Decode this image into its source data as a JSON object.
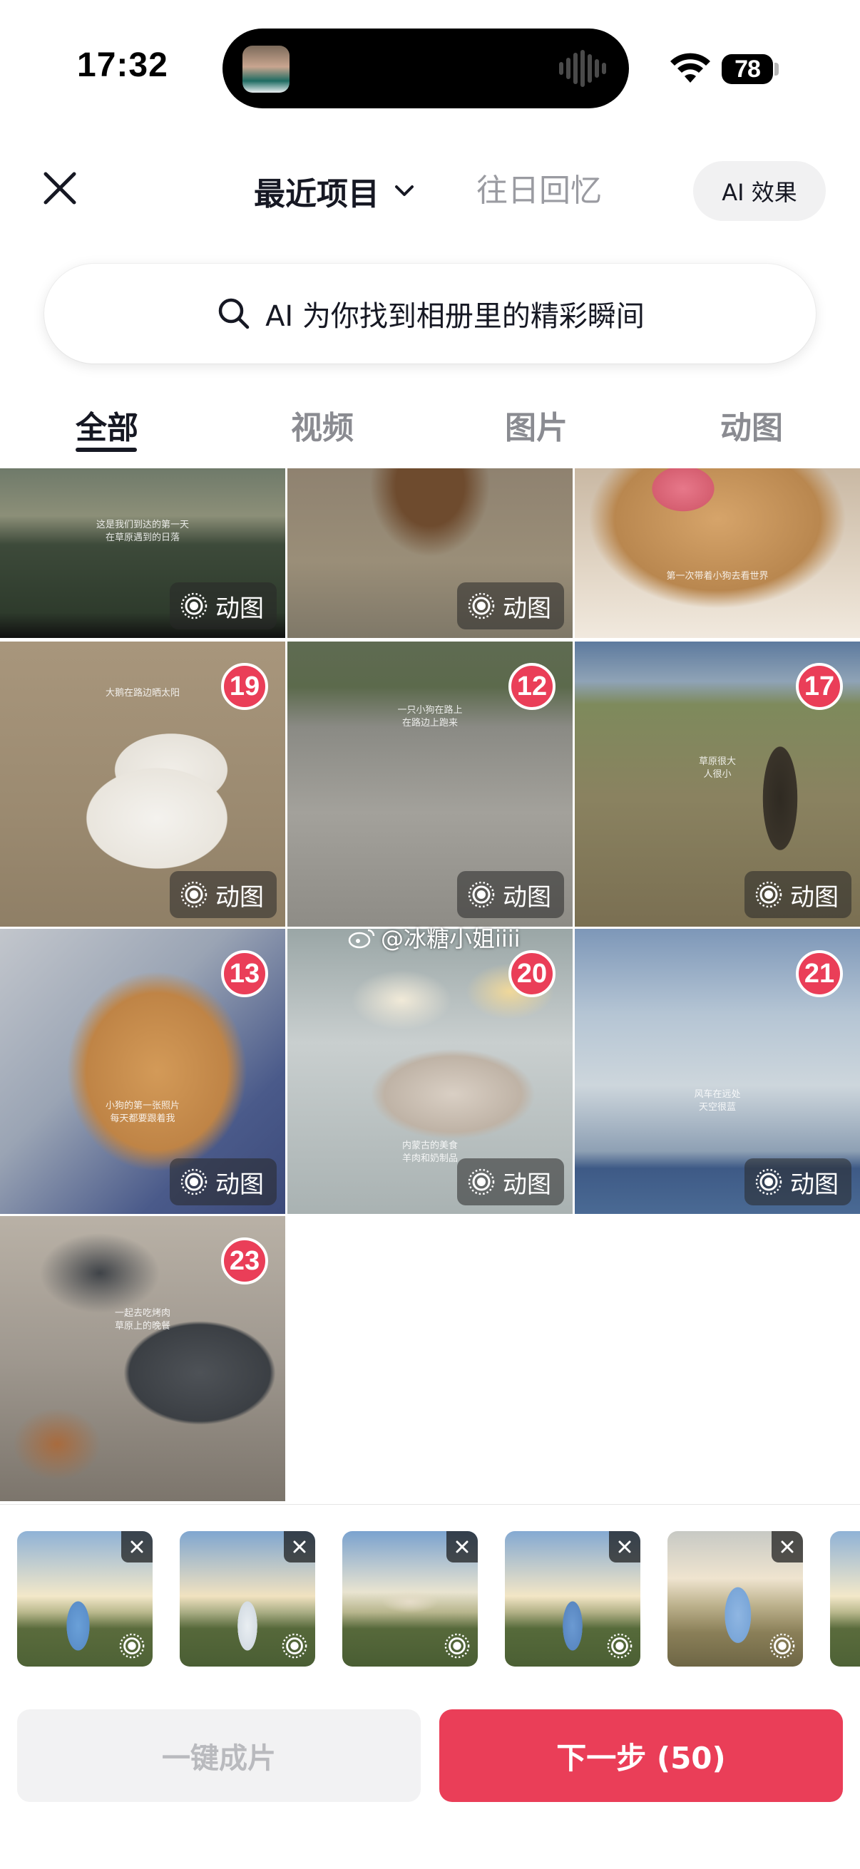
{
  "status_bar": {
    "time": "17:32",
    "battery": "78"
  },
  "header": {
    "album_title": "最近项目",
    "memories_tab": "往日回忆",
    "ai_effects": "AI 效果"
  },
  "search": {
    "placeholder": "AI 为你找到相册里的精彩瞬间"
  },
  "tabs": [
    {
      "label": "全部",
      "active": true
    },
    {
      "label": "视频",
      "active": false
    },
    {
      "label": "图片",
      "active": false
    },
    {
      "label": "动图",
      "active": false
    }
  ],
  "grid": {
    "gif_label": "动图",
    "items": [
      {
        "badge": "",
        "caption": "这是我们到达的第一天\n在草原遇到的日落",
        "gif": true
      },
      {
        "badge": "",
        "caption": "",
        "gif": true
      },
      {
        "badge": "",
        "caption": "第一次带着小狗去看世界",
        "gif": true
      },
      {
        "badge": "19",
        "caption": "大鹅在路边晒太阳",
        "gif": true
      },
      {
        "badge": "12",
        "caption": "一只小狗在路上\n在路边上跑来",
        "gif": true
      },
      {
        "badge": "17",
        "caption": "草原很大\n人很小",
        "gif": true
      },
      {
        "badge": "13",
        "caption": "小狗的第一张照片\n每天都要跟着我",
        "gif": true
      },
      {
        "badge": "20",
        "caption": "内蒙古的美食\n羊肉和奶制品",
        "gif": true
      },
      {
        "badge": "21",
        "caption": "风车在远处\n天空很蓝",
        "gif": true
      },
      {
        "badge": "23",
        "caption": "一起去吃烤肉\n草原上的晚餐",
        "gif": false
      }
    ]
  },
  "watermark": "@冰糖小姐iiii",
  "selected_count_visible": 6,
  "buttons": {
    "auto_create": "一键成片",
    "next": "下一步 (50)"
  },
  "colors": {
    "accent": "#ea3e58"
  }
}
